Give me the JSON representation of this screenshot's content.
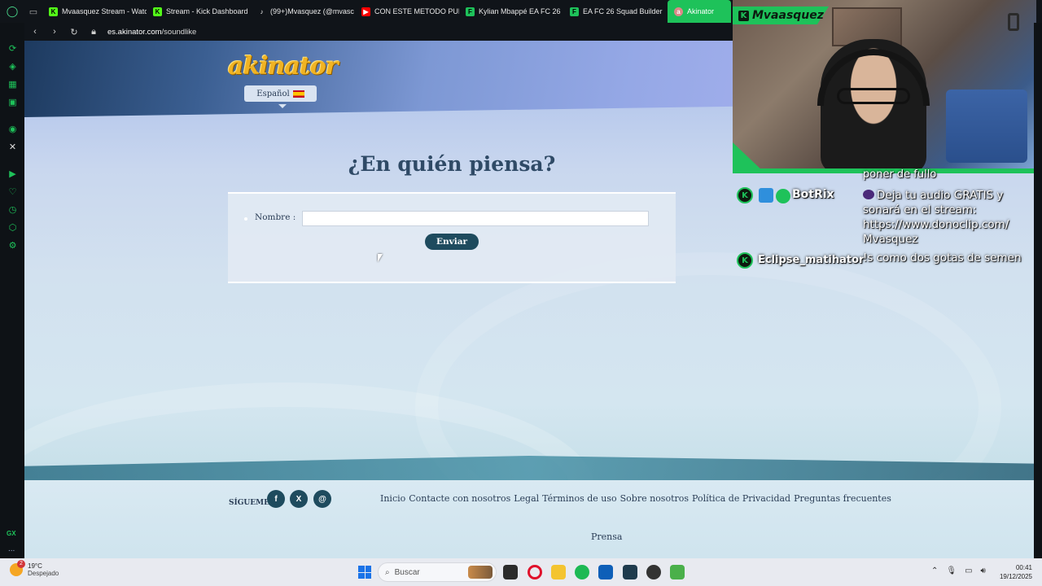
{
  "browser": {
    "tabs": [
      {
        "label": "Mvaasquez Stream - Watc",
        "icon": "kick-icon",
        "color": "#53fc18"
      },
      {
        "label": "Stream - Kick Dashboard",
        "icon": "kick-icon",
        "color": "#53fc18"
      },
      {
        "label": "(99+)Mvasquez (@mvasc",
        "icon": "tiktok-icon",
        "color": "#ffffff"
      },
      {
        "label": "CON ESTE METODO PUE",
        "icon": "youtube-icon",
        "color": "#ff0000"
      },
      {
        "label": "Kylian Mbappé EA FC 26",
        "icon": "futbin-icon",
        "color": "#1ec25a"
      },
      {
        "label": "EA FC 26 Squad Builder",
        "icon": "futbin-icon",
        "color": "#1ec25a"
      },
      {
        "label": "Akinator",
        "icon": "akinator-icon",
        "color": "#d88"
      }
    ],
    "url_domain": "es.akinator.com",
    "url_path": "/soundlike",
    "sidebar_gx_label": "GX",
    "sidebar_more": "..."
  },
  "site": {
    "logo_text": "akinator",
    "language": "Español",
    "question": "¿En quién piensa?",
    "name_label": "Nombre :",
    "name_value": "",
    "submit_label": "Enviar",
    "follow_label": "SÍGUEME",
    "social": [
      {
        "name": "facebook-icon",
        "glyph": "f"
      },
      {
        "name": "x-icon",
        "glyph": "X"
      },
      {
        "name": "threads-icon",
        "glyph": "@"
      }
    ],
    "footer_links": [
      "Inicio",
      "Contacte con nosotros",
      "Legal",
      "Términos de uso",
      "Sobre nosotros",
      "Política de Privacidad",
      "Preguntas frecuentes"
    ],
    "press_link": "Prensa"
  },
  "stream": {
    "streamer_name": "Mvaasquez",
    "chat_cutoff": "poner de fullo",
    "messages": [
      {
        "user": "BotRix",
        "text": "Deja tu audio GRATIS y sonará en el stream: https://www.donoclip.com/ Mvasquez"
      },
      {
        "user": "Eclipse_matihator",
        "text": "!s como dos gotas de semen"
      }
    ]
  },
  "taskbar": {
    "weather_temp": "19°C",
    "weather_desc": "Despejado",
    "weather_badge": "2",
    "search_placeholder": "Buscar",
    "time": "00:41",
    "date": "19/12/2025"
  }
}
